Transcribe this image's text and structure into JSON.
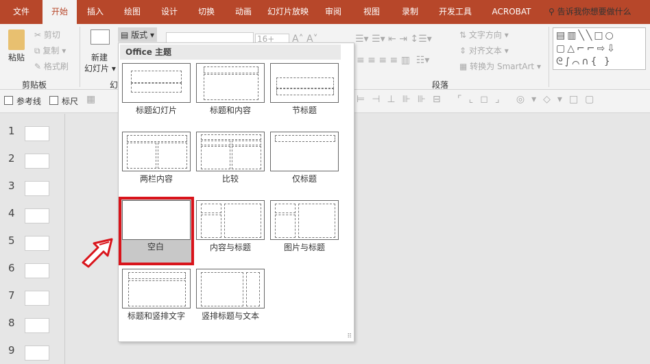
{
  "tabs": [
    "文件",
    "开始",
    "插入",
    "绘图",
    "设计",
    "切换",
    "动画",
    "幻灯片放映",
    "审阅",
    "视图",
    "录制",
    "开发工具",
    "ACROBAT"
  ],
  "active_tab": "开始",
  "tell_me": "告诉我你想要做什么",
  "ribbon": {
    "paste": "粘贴",
    "cut": "剪切",
    "copy": "复制",
    "format_painter": "格式刷",
    "clipboard_group": "剪贴板",
    "new_slide_1": "新建",
    "new_slide_2": "幻灯片",
    "slides_group": "幻",
    "layout_button": "版式",
    "font_size": "16+",
    "text_direction": "文字方向",
    "align_text": "对齐文本",
    "smartart": "转换为 SmartArt",
    "paragraph_group": "段落"
  },
  "bar2": {
    "guides": "参考线",
    "ruler": "标尺"
  },
  "slide_numbers": [
    "1",
    "2",
    "3",
    "4",
    "5",
    "6",
    "7",
    "8",
    "9"
  ],
  "layout_menu": {
    "header": "Office 主题",
    "selected": "空白",
    "layouts": [
      {
        "label": "标题幻灯片",
        "kind": "title"
      },
      {
        "label": "标题和内容",
        "kind": "title-content"
      },
      {
        "label": "节标题",
        "kind": "section"
      },
      {
        "label": "两栏内容",
        "kind": "two-content"
      },
      {
        "label": "比较",
        "kind": "comparison"
      },
      {
        "label": "仅标题",
        "kind": "title-only"
      },
      {
        "label": "空白",
        "kind": "blank"
      },
      {
        "label": "内容与标题",
        "kind": "content-caption"
      },
      {
        "label": "图片与标题",
        "kind": "picture-caption"
      },
      {
        "label": "标题和竖排文字",
        "kind": "title-vertical"
      },
      {
        "label": "竖排标题与文本",
        "kind": "vertical-title"
      }
    ]
  },
  "colors": {
    "brand": "#b7472a",
    "highlight": "#d9141b"
  }
}
